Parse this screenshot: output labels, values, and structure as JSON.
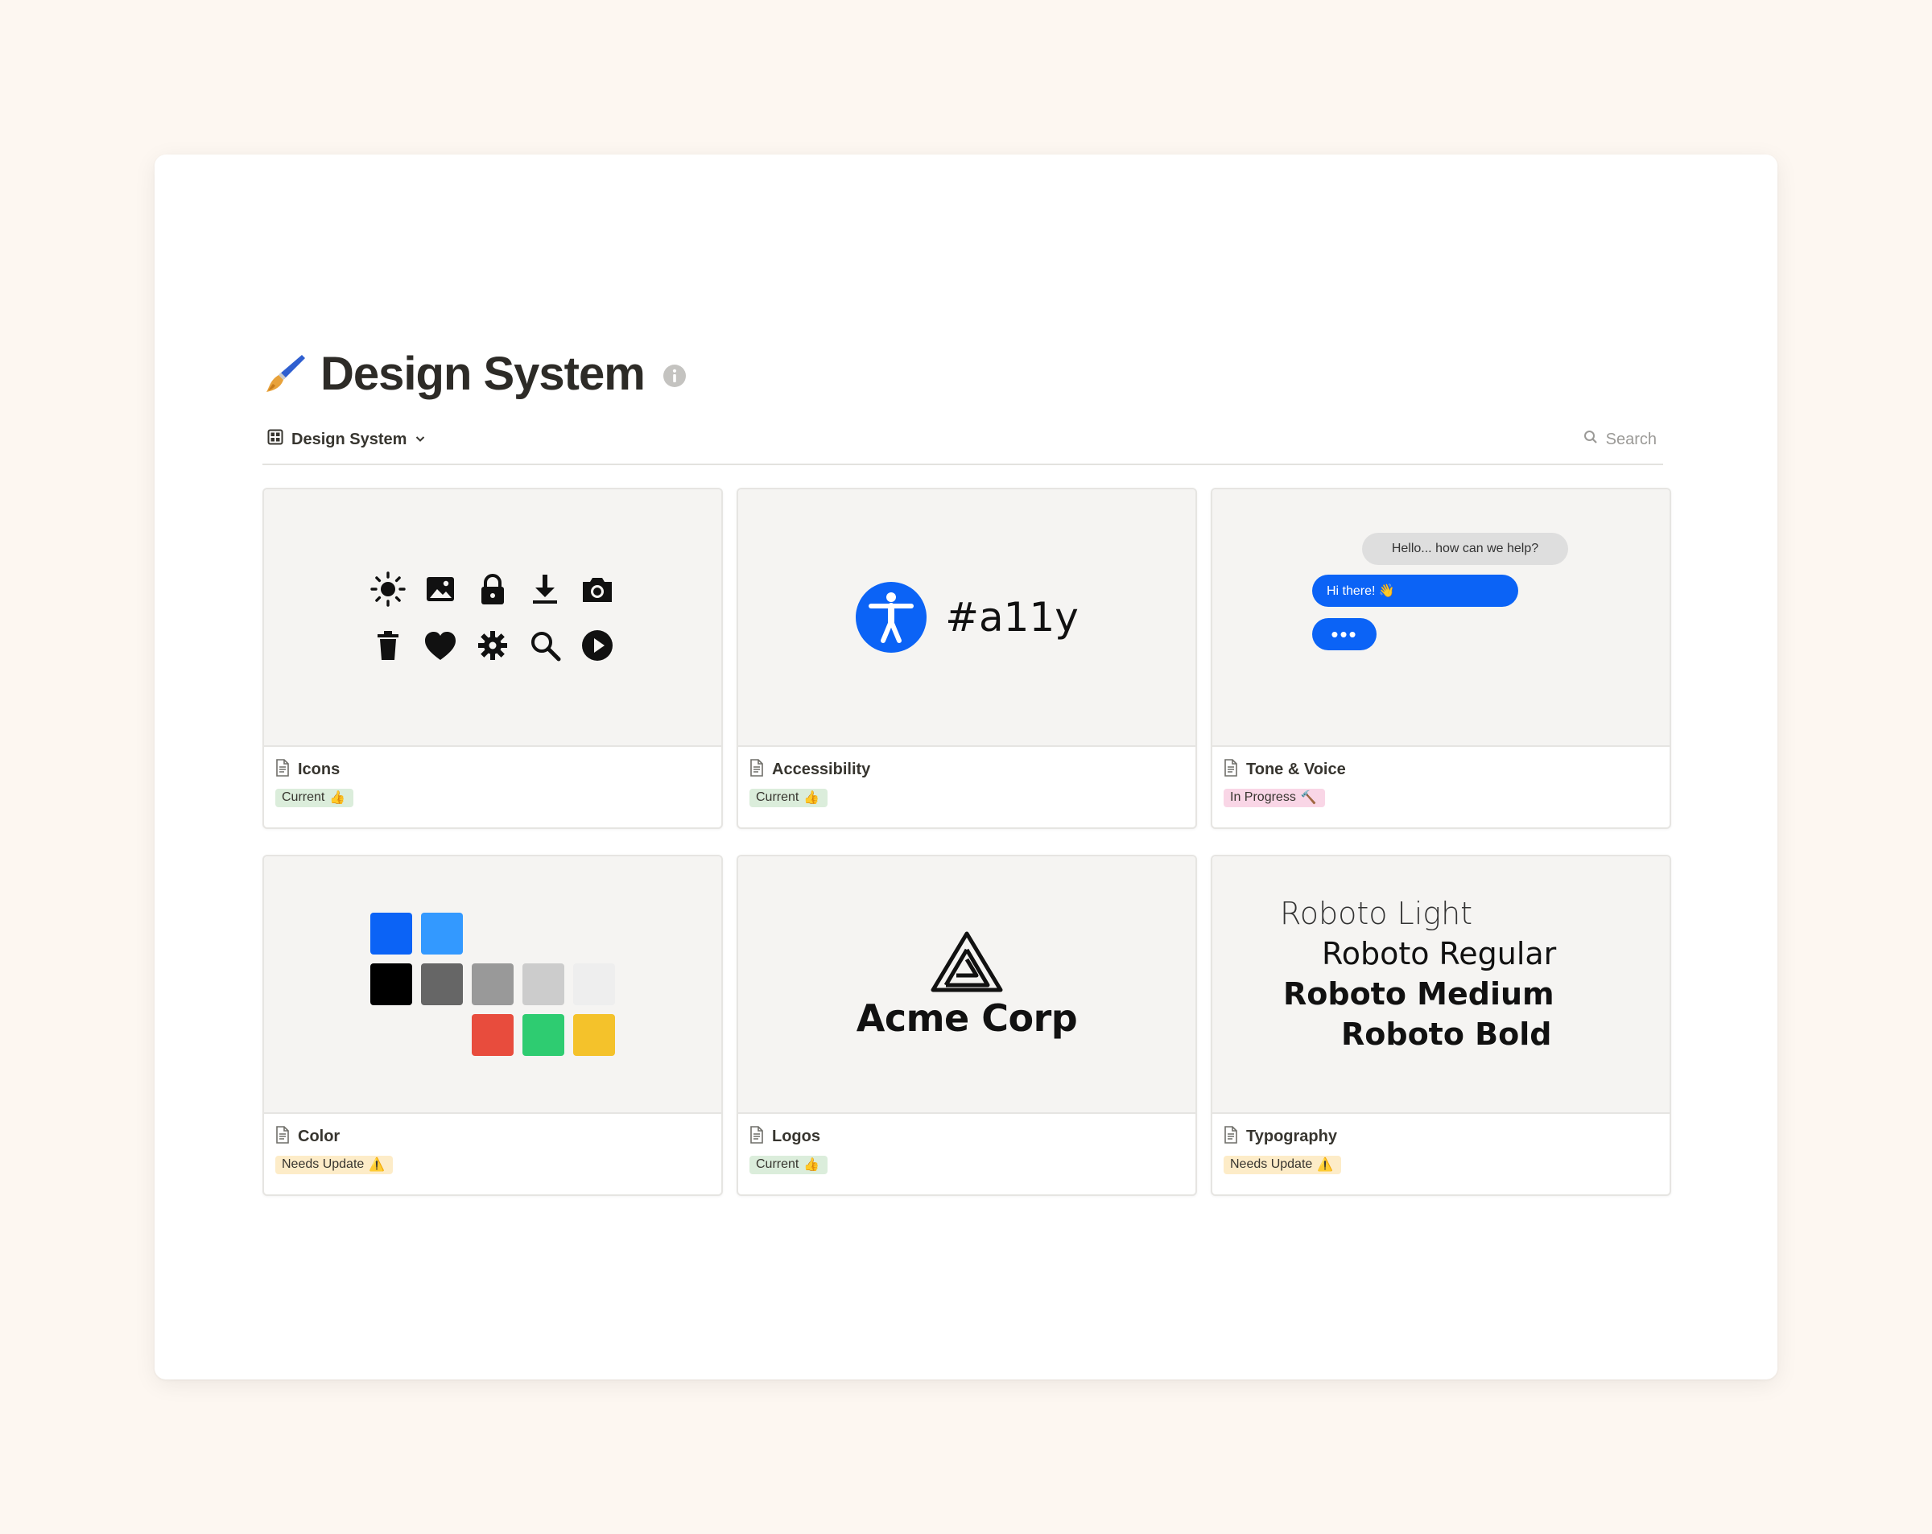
{
  "page": {
    "emoji_icon": "paintbrush-icon",
    "title": "Design System",
    "info_icon": "info-icon"
  },
  "toolbar": {
    "view_label": "Design System",
    "view_icon": "gallery-view-icon",
    "chevron_icon": "chevron-down-icon",
    "search_label": "Search",
    "search_icon": "search-icon"
  },
  "cards": [
    {
      "name": "Icons",
      "status": "Current",
      "status_emoji": "thumbs-up-icon",
      "status_color": "#dbeddb",
      "cover": "icon-set"
    },
    {
      "name": "Accessibility",
      "status": "Current",
      "status_emoji": "thumbs-up-icon",
      "status_color": "#dbeddb",
      "cover": "a11y"
    },
    {
      "name": "Tone & Voice",
      "status": "In Progress",
      "status_emoji": "hammer-icon",
      "status_color": "#f9d6e6",
      "cover": "chat"
    },
    {
      "name": "Color",
      "status": "Needs Update",
      "status_emoji": "warning-icon",
      "status_color": "#fdecc8",
      "cover": "palette"
    },
    {
      "name": "Logos",
      "status": "Current",
      "status_emoji": "thumbs-up-icon",
      "status_color": "#dbeddb",
      "cover": "logo"
    },
    {
      "name": "Typography",
      "status": "Needs Update",
      "status_emoji": "warning-icon",
      "status_color": "#fdecc8",
      "cover": "type"
    }
  ],
  "covers": {
    "icons": [
      "sun-icon",
      "image-icon",
      "lock-icon",
      "download-icon",
      "camera-icon",
      "trash-icon",
      "heart-icon",
      "gear-icon",
      "search-icon",
      "play-icon"
    ],
    "a11y": {
      "tag": "#a11y",
      "accent": "#0b63f6"
    },
    "chat": {
      "incoming": "Hello... how can we help?",
      "outgoing": "Hi there! 👋",
      "typing": "•••",
      "accent": "#0b63f6"
    },
    "palette": [
      "#0b63f6",
      "#3399ff",
      "#000000",
      "#666666",
      "#999999",
      "#cccccc",
      "#eeeeee",
      "#e84c3d",
      "#2ecc71",
      "#f4c22b"
    ],
    "logo": {
      "company": "Acme Corp"
    },
    "type": [
      "Roboto Light",
      "Roboto Regular",
      "Roboto Medium",
      "Roboto Bold"
    ]
  }
}
